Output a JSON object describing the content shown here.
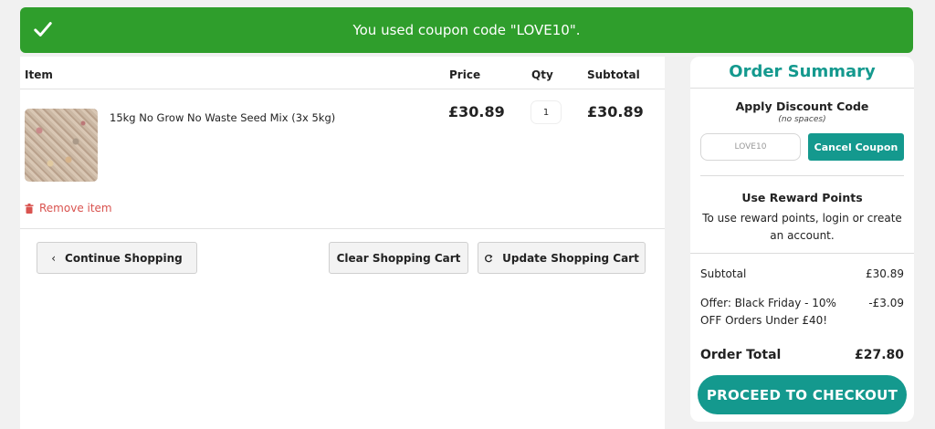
{
  "banner": {
    "message": "You used coupon code \"LOVE10\"."
  },
  "cart": {
    "headers": {
      "item": "Item",
      "price": "Price",
      "qty": "Qty",
      "subtotal": "Subtotal"
    },
    "items": [
      {
        "name": "15kg No Grow No Waste Seed Mix (3x 5kg)",
        "price": "£30.89",
        "qty": "1",
        "subtotal": "£30.89"
      }
    ],
    "remove_label": "Remove item",
    "buttons": {
      "continue": "Continue Shopping",
      "clear": "Clear Shopping Cart",
      "update": "Update Shopping Cart"
    }
  },
  "summary": {
    "title": "Order Summary",
    "discount": {
      "heading": "Apply Discount Code",
      "note": "(no spaces)",
      "value": "LOVE10",
      "cancel_label": "Cancel Coupon"
    },
    "rewards": {
      "heading": "Use Reward Points",
      "text": "To use reward points, login or create an account."
    },
    "subtotal_label": "Subtotal",
    "subtotal_value": "£30.89",
    "offer_label": "Offer: Black Friday - 10% OFF Orders Under £40!",
    "offer_value": "-£3.09",
    "total_label": "Order Total",
    "total_value": "£27.80",
    "checkout_label": "PROCEED TO CHECKOUT"
  },
  "colors": {
    "success": "#2f9e2c",
    "accent": "#14998e",
    "danger": "#d9534f"
  }
}
